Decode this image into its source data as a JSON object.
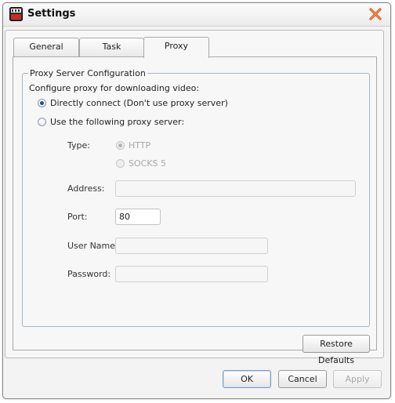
{
  "window": {
    "title": "Settings"
  },
  "tabs": [
    {
      "label": "General",
      "active": false
    },
    {
      "label": "Task",
      "active": false
    },
    {
      "label": "Proxy",
      "active": true
    }
  ],
  "proxy": {
    "group_title": "Proxy Server Configuration",
    "prompt": "Configure proxy for downloading video:",
    "options": {
      "direct": {
        "label": "Directly connect (Don't use proxy server)",
        "checked": true
      },
      "custom": {
        "label": "Use the following proxy server:",
        "checked": false
      }
    },
    "type_label": "Type:",
    "type_options": {
      "http": {
        "label": "HTTP",
        "checked": true
      },
      "socks": {
        "label": "SOCKS 5",
        "checked": false
      }
    },
    "address": {
      "label": "Address:",
      "value": ""
    },
    "port": {
      "label": "Port:",
      "value": "80"
    },
    "username": {
      "label": "User Name:",
      "value": ""
    },
    "password": {
      "label": "Password:",
      "value": ""
    },
    "restore_label": "Restore Defaults"
  },
  "footer": {
    "ok_label": "OK",
    "cancel_label": "Cancel",
    "apply_label": "Apply"
  },
  "colors": {
    "close_icon": "#e05a1c",
    "accent": "#2d4d8a",
    "app_icon_red": "#cc2a2a"
  },
  "icons": {
    "app": "video-download-icon",
    "close": "close-icon"
  }
}
